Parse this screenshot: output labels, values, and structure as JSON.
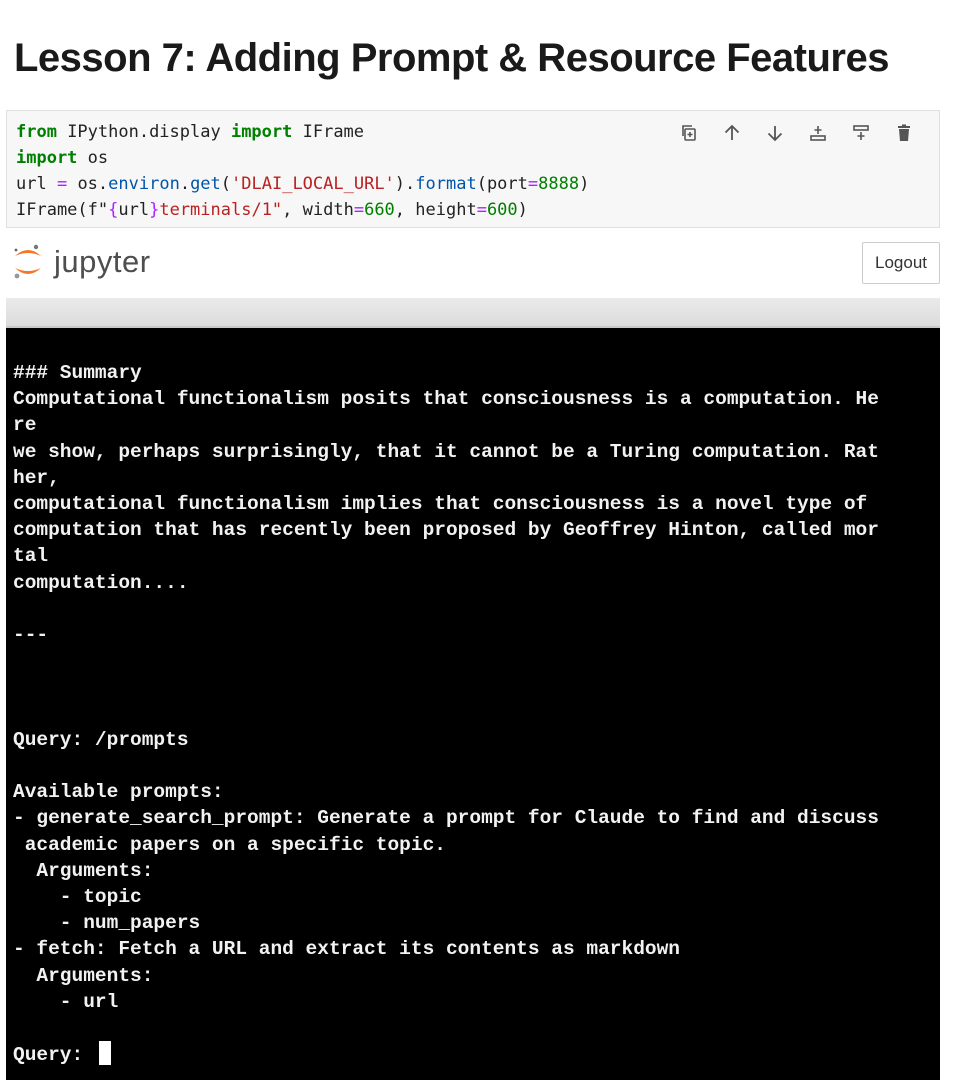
{
  "lesson": {
    "title": "Lesson 7: Adding Prompt & Resource Features"
  },
  "code_cell": {
    "line1": {
      "kw1": "from",
      "mod": " IPython.display ",
      "kw2": "import",
      "name": " IFrame"
    },
    "line2": {
      "kw": "import",
      "rest": " os"
    },
    "line3": {
      "a": "url ",
      "eq": "=",
      "b": " os.",
      "environ": "environ",
      "dot": ".",
      "get": "get",
      "p1": "(",
      "str": "'DLAI_LOCAL_URL'",
      "p2": ").",
      "format": "format",
      "p3": "(port",
      "eq2": "=",
      "num": "8888",
      "p4": ")"
    },
    "line4": {
      "a": "IFrame(f\"",
      "b1": "{",
      "var": "url",
      "b2": "}",
      "s": "terminals/1\"",
      "c": ", width",
      "eq1": "=",
      "w": "660",
      "d": ", height",
      "eq2": "=",
      "h": "600",
      "e": ")"
    },
    "toolbar_icons": [
      "copy-icon",
      "arrow-up-icon",
      "arrow-down-icon",
      "insert-above-icon",
      "insert-below-icon",
      "trash-icon"
    ]
  },
  "jupyter": {
    "wordmark": "jupyter",
    "logout_label": "Logout"
  },
  "terminal": {
    "lines": [
      "### Summary",
      "Computational functionalism posits that consciousness is a computation. He",
      "re",
      "we show, perhaps surprisingly, that it cannot be a Turing computation. Rat",
      "her,",
      "computational functionalism implies that consciousness is a novel type of",
      "computation that has recently been proposed by Geoffrey Hinton, called mor",
      "tal",
      "computation....",
      "",
      "---",
      "",
      "",
      "",
      "Query: /prompts",
      "",
      "Available prompts:",
      "- generate_search_prompt: Generate a prompt for Claude to find and discuss",
      " academic papers on a specific topic.",
      "  Arguments:",
      "    - topic",
      "    - num_papers",
      "- fetch: Fetch a URL and extract its contents as markdown",
      "  Arguments:",
      "    - url",
      ""
    ],
    "prompt": "Query: "
  },
  "colors": {
    "keyword": "#008000",
    "string": "#ba2121",
    "terminal_bg": "#000000",
    "terminal_fg": "#f2f2f2",
    "jupyter_orange": "#f37726"
  }
}
